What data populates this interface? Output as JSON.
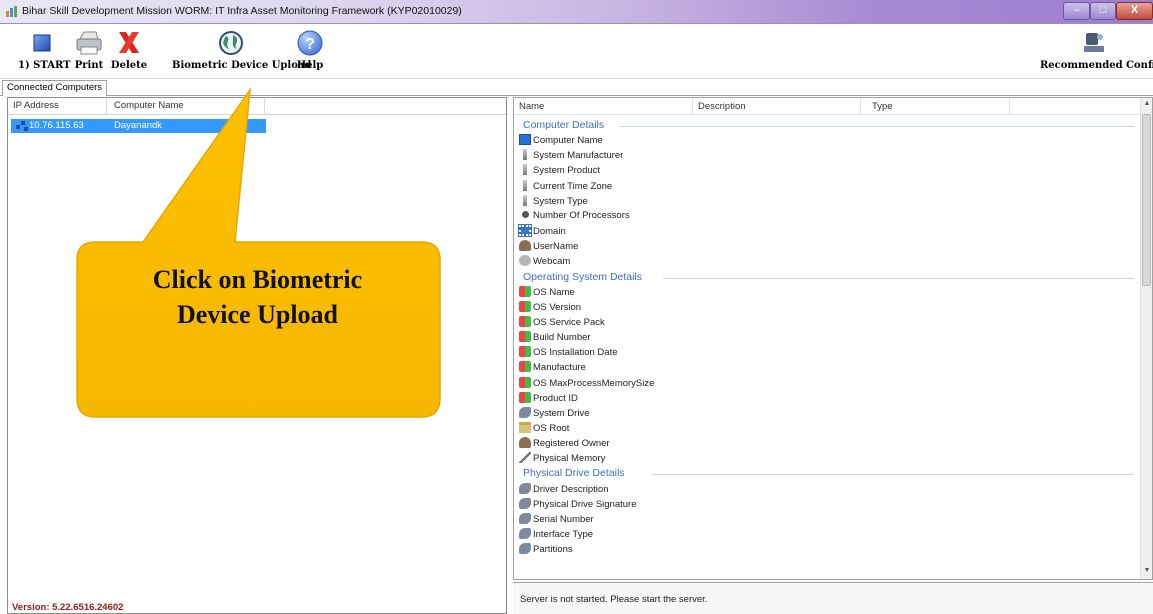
{
  "window": {
    "title": "Bihar Skill Development Mission WORM: IT Infra Asset Monitoring Framework (KYP02010029)",
    "min_glyph": "–",
    "max_glyph": "□",
    "close_glyph": "X"
  },
  "toolbar": {
    "start_label": "1) START",
    "print_label": "Print",
    "delete_label": "Delete",
    "biometric_label": "Biometric Device Upload",
    "help_label": "Help",
    "help_glyph": "?",
    "recommended_label": "Recommended Configuration"
  },
  "tabs": {
    "connected_computers": "Connected Computers"
  },
  "computers_list": {
    "columns": [
      "IP Address",
      "Computer Name"
    ],
    "rows": [
      {
        "ip": "10.76.115.63",
        "name": "Dayanandk"
      }
    ]
  },
  "version_label": "Version: 5.22.6516.24602",
  "details": {
    "columns": [
      "Name",
      "Description",
      "Type"
    ],
    "groups": [
      {
        "title": "Computer Details",
        "items": [
          {
            "label": "Computer Name",
            "icon": "monitor-icon"
          },
          {
            "label": "System Manufacturer",
            "icon": "bar-icon"
          },
          {
            "label": "System Product",
            "icon": "bar-icon"
          },
          {
            "label": "Current Time Zone",
            "icon": "bar-icon"
          },
          {
            "label": "System Type",
            "icon": "bar-icon"
          },
          {
            "label": "Number Of Processors",
            "icon": "dot-icon"
          },
          {
            "label": "Domain",
            "icon": "network-icon"
          },
          {
            "label": "UserName",
            "icon": "user-icon"
          },
          {
            "label": "Webcam",
            "icon": "webcam-icon"
          }
        ]
      },
      {
        "title": "Operating System Details",
        "items": [
          {
            "label": "OS Name",
            "icon": "windows-icon"
          },
          {
            "label": "OS Version",
            "icon": "windows-icon"
          },
          {
            "label": "OS Service Pack",
            "icon": "windows-icon"
          },
          {
            "label": "Build Number",
            "icon": "windows-icon"
          },
          {
            "label": "OS Installation Date",
            "icon": "windows-icon"
          },
          {
            "label": "Manufacture",
            "icon": "windows-icon"
          },
          {
            "label": "OS MaxProcessMemorySize",
            "icon": "windows-icon"
          },
          {
            "label": "Product ID",
            "icon": "windows-icon"
          },
          {
            "label": "System Drive",
            "icon": "drive-icon"
          },
          {
            "label": "OS Root",
            "icon": "folder-icon"
          },
          {
            "label": "Registered Owner",
            "icon": "user-icon"
          },
          {
            "label": "Physical Memory",
            "icon": "memory-icon"
          }
        ]
      },
      {
        "title": "Physical Drive Details",
        "items": [
          {
            "label": "Driver Description",
            "icon": "drive-icon"
          },
          {
            "label": "Physical Drive Signature",
            "icon": "drive-icon"
          },
          {
            "label": "Serial Number",
            "icon": "drive-icon"
          },
          {
            "label": "Interface Type",
            "icon": "drive-icon"
          },
          {
            "label": "Partitions",
            "icon": "drive-icon"
          }
        ]
      }
    ]
  },
  "status_text": "Server is not started. Please start the server.",
  "callout": {
    "line1": "Click on Biometric",
    "line2": "Device Upload"
  },
  "colors": {
    "callout_fill": "#ffc000",
    "selection": "#3399ff",
    "group_title": "#3c6ec2",
    "version_text": "#8b1a1a"
  }
}
